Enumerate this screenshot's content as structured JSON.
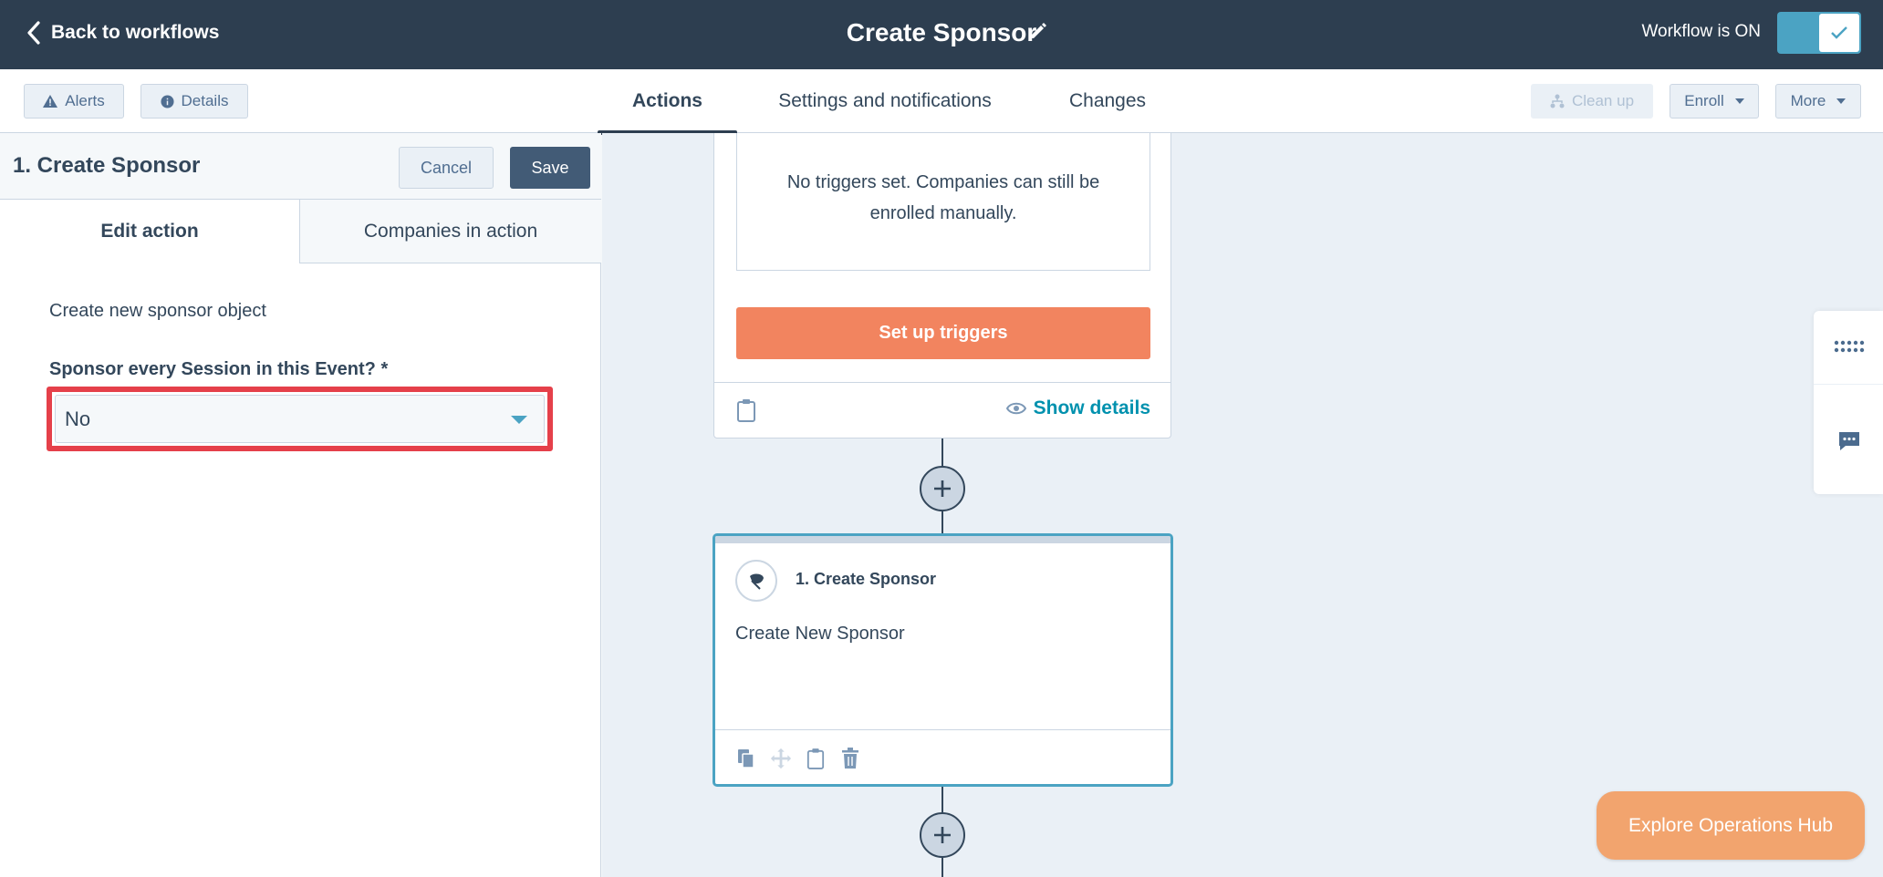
{
  "header": {
    "back_label": "Back to workflows",
    "title": "Create Sponsor",
    "status": "Workflow is ON",
    "toggle_on": true
  },
  "toolbar": {
    "alerts_label": "Alerts",
    "details_label": "Details",
    "tabs": [
      {
        "label": "Actions",
        "active": true
      },
      {
        "label": "Settings and notifications",
        "active": false
      },
      {
        "label": "Changes",
        "active": false
      }
    ],
    "cleanup_label": "Clean up",
    "enroll_label": "Enroll",
    "more_label": "More"
  },
  "panel": {
    "title": "1. Create Sponsor",
    "cancel_label": "Cancel",
    "save_label": "Save",
    "tabs": [
      {
        "label": "Edit action",
        "active": true
      },
      {
        "label": "Companies in action",
        "active": false
      }
    ],
    "description": "Create new sponsor object",
    "field_label": "Sponsor every Session in this Event? *",
    "field_value": "No"
  },
  "canvas": {
    "trigger_text": "No triggers set. Companies can still be enrolled manually.",
    "trigger_button": "Set up triggers",
    "show_details": "Show details",
    "action_title": "1. Create Sponsor",
    "action_desc": "Create New Sponsor"
  },
  "explore_label": "Explore Operations Hub",
  "colors": {
    "header_bg": "#2d3e50",
    "accent": "#4ba3c3",
    "trigger_btn": "#f2845f",
    "highlight": "#e5404a",
    "explore_btn": "#f2a46e"
  }
}
